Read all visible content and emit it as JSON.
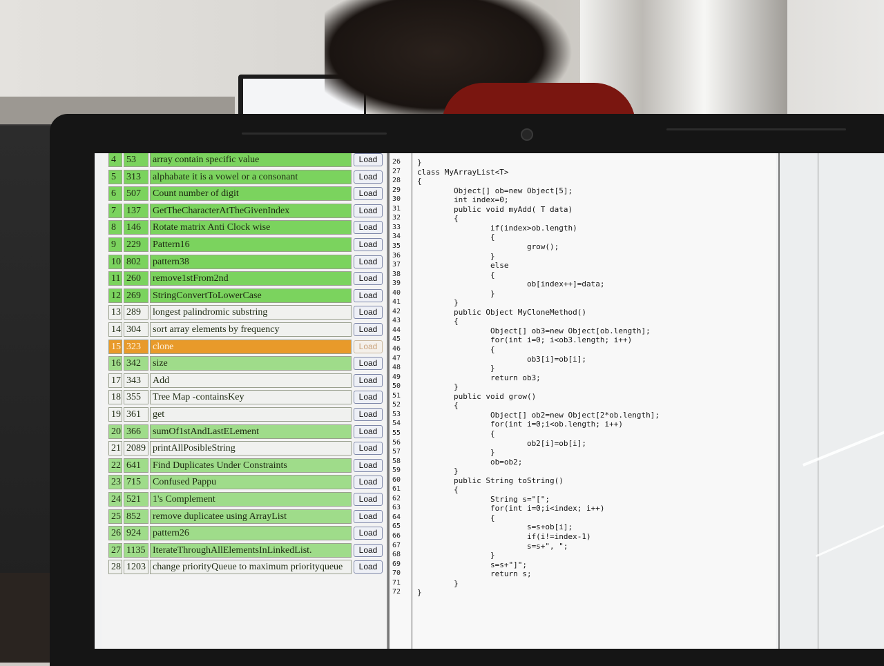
{
  "rows": [
    {
      "idx": "4",
      "id": "53",
      "name": "array contain specific value",
      "load": "Load",
      "style": "green"
    },
    {
      "idx": "5",
      "id": "313",
      "name": "alphabate it is a vowel or a consonant",
      "load": "Load",
      "style": "green"
    },
    {
      "idx": "6",
      "id": "507",
      "name": "Count number of digit",
      "load": "Load",
      "style": "green"
    },
    {
      "idx": "7",
      "id": "137",
      "name": "GetTheCharacterAtTheGivenIndex",
      "load": "Load",
      "style": "green"
    },
    {
      "idx": "8",
      "id": "146",
      "name": "Rotate matrix Anti Clock wise",
      "load": "Load",
      "style": "green"
    },
    {
      "idx": "9",
      "id": "229",
      "name": "Pattern16",
      "load": "Load",
      "style": "green"
    },
    {
      "idx": "10",
      "id": "802",
      "name": "pattern38",
      "load": "Load",
      "style": "green"
    },
    {
      "idx": "11",
      "id": "260",
      "name": "remove1stFrom2nd",
      "load": "Load",
      "style": "green"
    },
    {
      "idx": "12",
      "id": "269",
      "name": "StringConvertToLowerCase",
      "load": "Load",
      "style": "green"
    },
    {
      "idx": "13",
      "id": "289",
      "name": "longest palindromic substring",
      "load": "Load",
      "style": "white"
    },
    {
      "idx": "14",
      "id": "304",
      "name": "sort array elements by frequency",
      "load": "Load",
      "style": "white"
    },
    {
      "idx": "15",
      "id": "323",
      "name": "clone",
      "load": "Load",
      "style": "orange"
    },
    {
      "idx": "16",
      "id": "342",
      "name": "size",
      "load": "Load",
      "style": "lgreen"
    },
    {
      "idx": "17",
      "id": "343",
      "name": "Add",
      "load": "Load",
      "style": "white"
    },
    {
      "idx": "18",
      "id": "355",
      "name": "Tree Map -containsKey",
      "load": "Load",
      "style": "white"
    },
    {
      "idx": "19",
      "id": "361",
      "name": "get",
      "load": "Load",
      "style": "white"
    },
    {
      "idx": "20",
      "id": "366",
      "name": "sumOf1stAndLastELement",
      "load": "Load",
      "style": "lgreen"
    },
    {
      "idx": "21",
      "id": "2089",
      "name": "printAllPosibleString",
      "load": "Load",
      "style": "white"
    },
    {
      "idx": "22",
      "id": "641",
      "name": "Find Duplicates Under Constraints",
      "load": "Load",
      "style": "lgreen"
    },
    {
      "idx": "23",
      "id": "715",
      "name": "Confused Pappu",
      "load": "Load",
      "style": "lgreen"
    },
    {
      "idx": "24",
      "id": "521",
      "name": "1's Complement",
      "load": "Load",
      "style": "lgreen"
    },
    {
      "idx": "25",
      "id": "852",
      "name": "remove duplicatee using ArrayList",
      "load": "Load",
      "style": "lgreen"
    },
    {
      "idx": "26",
      "id": "924",
      "name": "pattern26",
      "load": "Load",
      "style": "lgreen"
    },
    {
      "idx": "27",
      "id": "1135",
      "name": "IterateThroughAllElementsInLinkedList.",
      "load": "Load",
      "style": "lgreen"
    },
    {
      "idx": "28",
      "id": "1203",
      "name": "change priorityQueue to maximum priorityqueue",
      "load": "Load",
      "style": "white"
    }
  ],
  "code_lines": [
    {
      "n": "26",
      "t": "}"
    },
    {
      "n": "27",
      "t": "class MyArrayList<T>"
    },
    {
      "n": "28",
      "t": "{"
    },
    {
      "n": "29",
      "t": "        Object[] ob=new Object[5];"
    },
    {
      "n": "30",
      "t": "        int index=0;"
    },
    {
      "n": "31",
      "t": "        public void myAdd( T data)"
    },
    {
      "n": "32",
      "t": "        {"
    },
    {
      "n": "33",
      "t": "                if(index>ob.length)"
    },
    {
      "n": "34",
      "t": "                {"
    },
    {
      "n": "35",
      "t": "                        grow();"
    },
    {
      "n": "36",
      "t": "                }"
    },
    {
      "n": "37",
      "t": "                else"
    },
    {
      "n": "38",
      "t": "                {"
    },
    {
      "n": "39",
      "t": "                        ob[index++]=data;"
    },
    {
      "n": "40",
      "t": "                }"
    },
    {
      "n": "41",
      "t": "        }"
    },
    {
      "n": "42",
      "t": "        public Object MyCloneMethod()"
    },
    {
      "n": "43",
      "t": "        {"
    },
    {
      "n": "44",
      "t": "                Object[] ob3=new Object[ob.length];"
    },
    {
      "n": "45",
      "t": "                for(int i=0; i<ob3.length; i++)"
    },
    {
      "n": "46",
      "t": "                {"
    },
    {
      "n": "47",
      "t": "                        ob3[i]=ob[i];"
    },
    {
      "n": "48",
      "t": "                }"
    },
    {
      "n": "49",
      "t": "                return ob3;"
    },
    {
      "n": "50",
      "t": "        }"
    },
    {
      "n": "51",
      "t": "        public void grow()"
    },
    {
      "n": "52",
      "t": "        {"
    },
    {
      "n": "53",
      "t": "                Object[] ob2=new Object[2*ob.length];"
    },
    {
      "n": "54",
      "t": "                for(int i=0;i<ob.length; i++)"
    },
    {
      "n": "55",
      "t": "                {"
    },
    {
      "n": "56",
      "t": "                        ob2[i]=ob[i];"
    },
    {
      "n": "57",
      "t": "                }"
    },
    {
      "n": "58",
      "t": "                ob=ob2;"
    },
    {
      "n": "59",
      "t": "        }"
    },
    {
      "n": "60",
      "t": "        public String toString()"
    },
    {
      "n": "61",
      "t": "        {"
    },
    {
      "n": "62",
      "t": "                String s=\"[\";"
    },
    {
      "n": "63",
      "t": "                for(int i=0;i<index; i++)"
    },
    {
      "n": "64",
      "t": "                {"
    },
    {
      "n": "65",
      "t": "                        s=s+ob[i];"
    },
    {
      "n": "66",
      "t": "                        if(i!=index-1)"
    },
    {
      "n": "67",
      "t": "                        s=s+\", \";"
    },
    {
      "n": "68",
      "t": "                }"
    },
    {
      "n": "69",
      "t": "                s=s+\"]\";"
    },
    {
      "n": "70",
      "t": "                return s;"
    },
    {
      "n": "71",
      "t": "        }"
    },
    {
      "n": "72",
      "t": "}"
    }
  ]
}
